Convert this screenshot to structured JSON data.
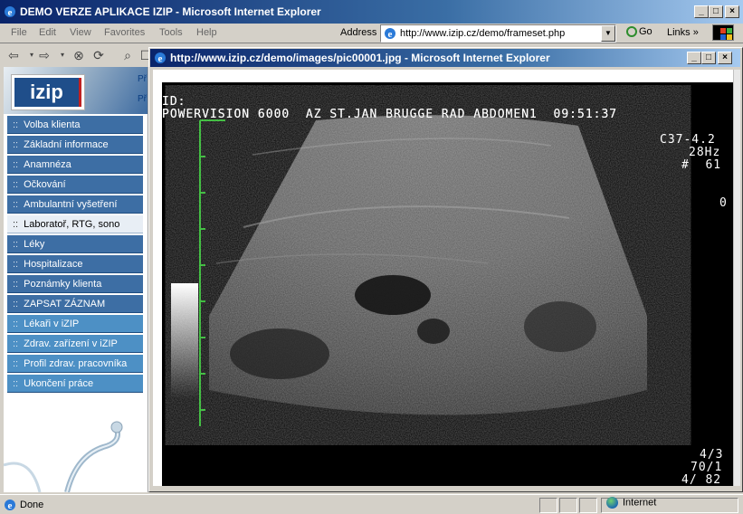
{
  "main_window": {
    "title": "DEMO VERZE APLIKACE IZIP - Microsoft Internet Explorer",
    "controls": [
      "_",
      "□",
      "×"
    ]
  },
  "menu": {
    "items": [
      "File",
      "Edit",
      "View",
      "Favorites",
      "Tools",
      "Help"
    ],
    "address_label": "Address",
    "address_value": "http://www.izip.cz/demo/frameset.php",
    "go_label": "Go",
    "links_label": "Links"
  },
  "toolbar": {
    "icons": [
      "back-arrow-icon",
      "forward-arrow-icon",
      "stop-icon",
      "refresh-icon",
      "search-icon"
    ]
  },
  "sidebar": {
    "logo": "izip",
    "logo_side_lines": [
      "Př",
      "Př"
    ],
    "items": [
      {
        "label": "Volba klienta",
        "style": "normal"
      },
      {
        "label": "Základní informace",
        "style": "normal"
      },
      {
        "label": "Anamnéza",
        "style": "normal"
      },
      {
        "label": "Očkování",
        "style": "normal"
      },
      {
        "label": "Ambulantní vyšetření",
        "style": "normal"
      },
      {
        "label": "Laboratoř, RTG, sono",
        "style": "active"
      },
      {
        "label": "Léky",
        "style": "normal"
      },
      {
        "label": "Hospitalizace",
        "style": "normal"
      },
      {
        "label": "Poznámky klienta",
        "style": "normal"
      },
      {
        "label": "ZAPSAT ZÁZNAM",
        "style": "normal"
      },
      {
        "label": "Lékaři v iZIP",
        "style": "alt"
      },
      {
        "label": "Zdrav. zařízení v iZIP",
        "style": "alt"
      },
      {
        "label": "Profil zdrav. pracovníka",
        "style": "alt"
      },
      {
        "label": "Ukončení práce",
        "style": "alt"
      }
    ]
  },
  "popup": {
    "title": "http://www.izip.cz/demo/images/pic00001.jpg - Microsoft Internet Explorer",
    "image": {
      "line1": "ID:",
      "line2": "POWERVISION 6000  AZ ST.JAN BRUGGE RAD ABDOMEN1  09:51:37",
      "probe": "C37-4.2",
      "freq": "28Hz",
      "frame": "#  61",
      "zero": "0",
      "br1": "4/3",
      "br2": "70/1",
      "br3": "4/ 82"
    }
  },
  "status": {
    "text": "Done",
    "zone": "Internet"
  },
  "colors": {
    "title_gradient_start": "#0a246a",
    "nav_blue": "#3d6ea4",
    "nav_alt": "#4d90c5"
  }
}
